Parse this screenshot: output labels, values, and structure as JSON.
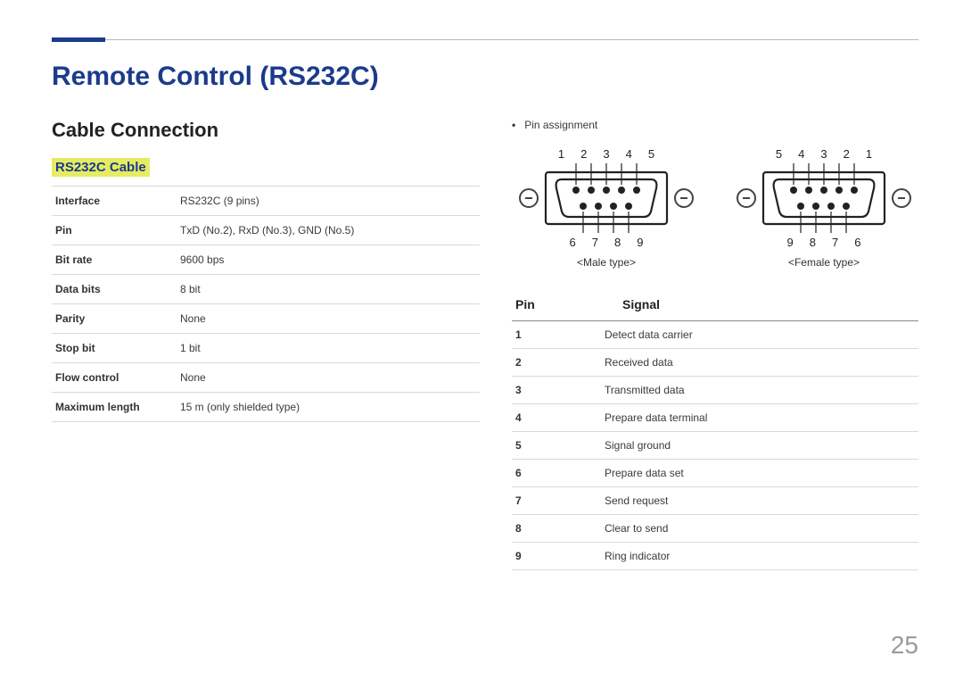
{
  "page_number": "25",
  "title": "Remote Control (RS232C)",
  "section": "Cable Connection",
  "subsection": "RS232C Cable",
  "bullet_label": "Pin assignment",
  "spec_table": [
    {
      "k": "Interface",
      "v": "RS232C (9 pins)"
    },
    {
      "k": "Pin",
      "v": "TxD (No.2), RxD (No.3), GND (No.5)"
    },
    {
      "k": "Bit rate",
      "v": "9600 bps"
    },
    {
      "k": "Data bits",
      "v": "8 bit"
    },
    {
      "k": "Parity",
      "v": "None"
    },
    {
      "k": "Stop bit",
      "v": "1 bit"
    },
    {
      "k": "Flow control",
      "v": "None"
    },
    {
      "k": "Maximum length",
      "v": "15 m (only shielded type)"
    }
  ],
  "connectors": {
    "male": {
      "top_nums": [
        "1",
        "2",
        "3",
        "4",
        "5"
      ],
      "bot_nums": [
        "6",
        "7",
        "8",
        "9"
      ],
      "label": "<Male type>"
    },
    "female": {
      "top_nums": [
        "5",
        "4",
        "3",
        "2",
        "1"
      ],
      "bot_nums": [
        "9",
        "8",
        "7",
        "6"
      ],
      "label": "<Female type>"
    }
  },
  "pin_header": {
    "c1": "Pin",
    "c2": "Signal"
  },
  "pin_signals": [
    {
      "pin": "1",
      "signal": "Detect data carrier"
    },
    {
      "pin": "2",
      "signal": "Received data"
    },
    {
      "pin": "3",
      "signal": "Transmitted data"
    },
    {
      "pin": "4",
      "signal": "Prepare data terminal"
    },
    {
      "pin": "5",
      "signal": "Signal ground"
    },
    {
      "pin": "6",
      "signal": "Prepare data set"
    },
    {
      "pin": "7",
      "signal": "Send request"
    },
    {
      "pin": "8",
      "signal": "Clear to send"
    },
    {
      "pin": "9",
      "signal": "Ring indicator"
    }
  ]
}
